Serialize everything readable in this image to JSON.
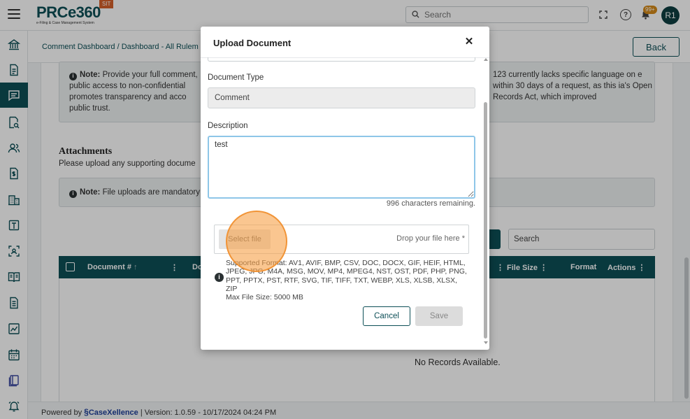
{
  "app": {
    "logo_text": "PRCe360",
    "logo_sub": "e-Filing & Case Management System",
    "env_badge": "SIT",
    "search_placeholder": "Search",
    "notif_count": "99+",
    "avatar_initials": "R1"
  },
  "breadcrumb": "Comment Dashboard / Dashboard - All Rulem",
  "back_label": "Back",
  "note1": {
    "label": "Note:",
    "left_text": "Provide your full comment, public access to non-confidential promotes transparency and acco public trust.",
    "right_text": "123 currently lacks specific language on e within 30 days of a request, as this ia's Open Records Act, which improved"
  },
  "attachments": {
    "title": "Attachments",
    "subtitle": "Please upload any supporting docume",
    "note_label": "Note:",
    "note_text": "File uploads are mandatory",
    "search_placeholder": "Search",
    "columns": [
      "Document #",
      "Do",
      "File Size",
      "Format",
      "Actions"
    ],
    "no_records": "No Records Available."
  },
  "modal": {
    "title": "Upload Document",
    "doc_type_label": "Document Type",
    "doc_type_value": "Comment",
    "description_label": "Description",
    "description_value": "test",
    "chars_remaining": "996 characters remaining.",
    "select_file": "Select file",
    "drop_text": "Drop your file here *",
    "formats": "Supported Format: AV1, AVIF, BMP, CSV, DOC, DOCX, GIF, HEIF, HTML, JPEG, JPG, M4A, MSG, MOV, MP4, MPEG4, NST, OST, PDF, PHP, PNG, PPT, PPTX, PST, RTF, SVG, TIF, TIFF, TXT, WEBP, XLS, XLSB, XLSX, ZIP",
    "max_size": "Max File Size: 5000 MB",
    "cancel": "Cancel",
    "save": "Save"
  },
  "footer": {
    "powered_by": "Powered by",
    "brand": "CaseXellence",
    "version": "|  Version: 1.0.59 - 10/17/2024 04:24 PM"
  },
  "colors": {
    "primary": "#0d4f57",
    "badge": "#d4602a",
    "highlight": "#f7a046"
  },
  "nav_icons": [
    "bank-icon",
    "document-icon",
    "comment-icon",
    "search-document-icon",
    "users-icon",
    "dollar-document-icon",
    "building-icon",
    "form-icon",
    "scan-icon",
    "book-icon",
    "page-icon",
    "chart-icon",
    "calendar-icon",
    "library-icon",
    "alarm-icon"
  ]
}
